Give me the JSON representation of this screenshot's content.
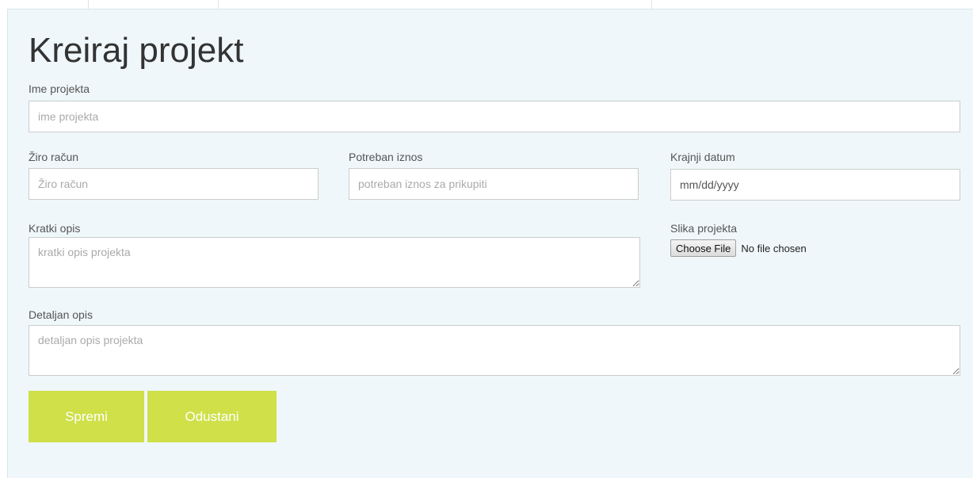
{
  "page": {
    "title": "Kreiraj projekt"
  },
  "form": {
    "name": {
      "label": "Ime projekta",
      "placeholder": "ime projekta"
    },
    "account": {
      "label": "Žiro račun",
      "placeholder": "Žiro račun"
    },
    "amount": {
      "label": "Potreban iznos",
      "placeholder": "potreban iznos za prikupiti"
    },
    "end_date": {
      "label": "Krajnji datum",
      "value": "mm/dd/yyyy"
    },
    "short_desc": {
      "label": "Kratki opis",
      "placeholder": "kratki opis projekta"
    },
    "image": {
      "label": "Slika projekta",
      "button": "Choose File",
      "status": "No file chosen"
    },
    "detail_desc": {
      "label": "Detaljan opis",
      "placeholder": "detaljan opis projekta"
    }
  },
  "actions": {
    "save": "Spremi",
    "cancel": "Odustani"
  },
  "colors": {
    "panel": "#eff7fa",
    "accent": "#cfe049"
  }
}
